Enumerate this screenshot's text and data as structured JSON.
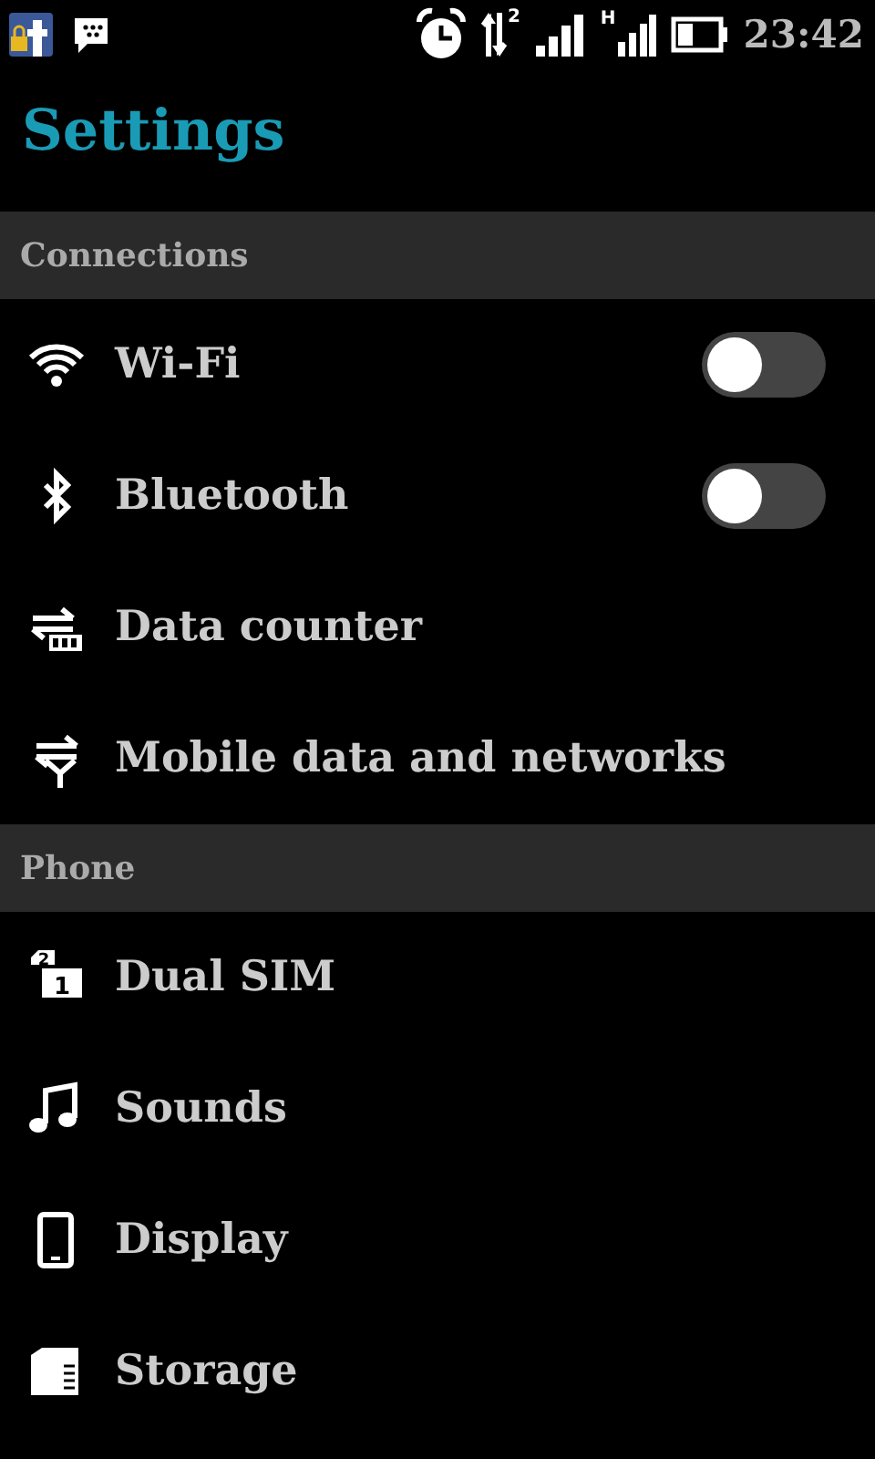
{
  "status_bar": {
    "data_badge": "2",
    "network_badge": "H",
    "time": "23:42"
  },
  "title": "Settings",
  "sections": [
    {
      "header": "Connections",
      "items": [
        {
          "label": "Wi-Fi",
          "kind": "toggle",
          "on": false
        },
        {
          "label": "Bluetooth",
          "kind": "toggle",
          "on": false
        },
        {
          "label": "Data counter",
          "kind": "plain"
        },
        {
          "label": "Mobile data and networks",
          "kind": "plain"
        }
      ]
    },
    {
      "header": "Phone",
      "items": [
        {
          "label": "Dual SIM",
          "kind": "plain",
          "icon_digits": [
            "2",
            "1"
          ]
        },
        {
          "label": "Sounds",
          "kind": "plain"
        },
        {
          "label": "Display",
          "kind": "plain"
        },
        {
          "label": "Storage",
          "kind": "plain"
        }
      ]
    }
  ]
}
